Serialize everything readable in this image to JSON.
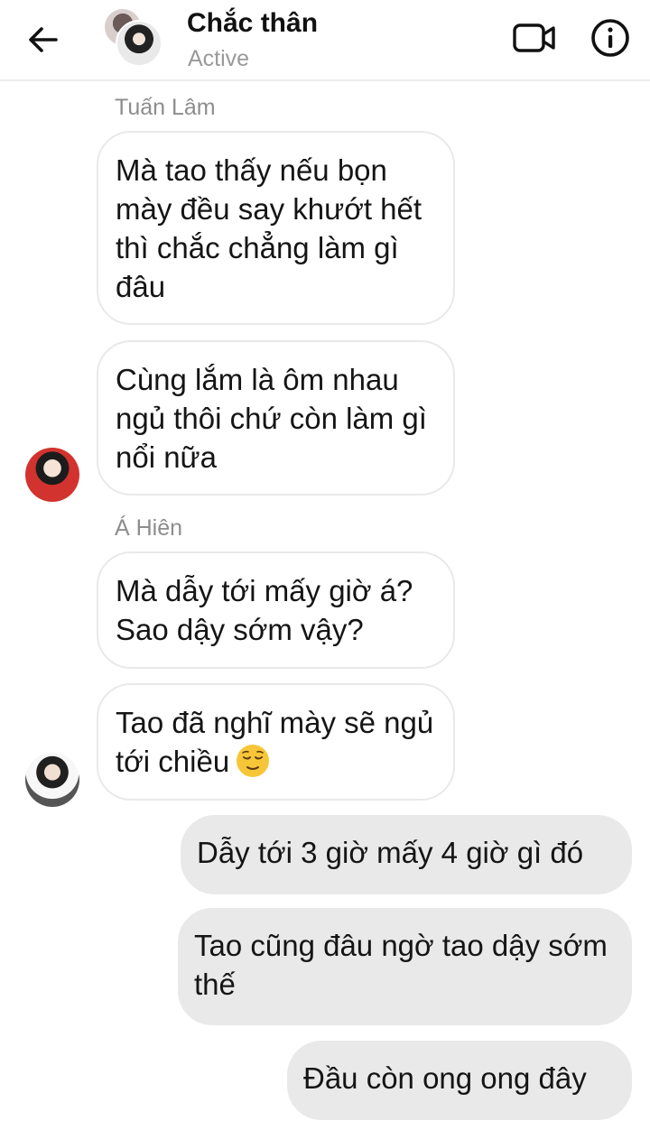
{
  "header": {
    "title": "Chắc thân",
    "status": "Active"
  },
  "messages": {
    "sender_tuan": "Tuấn Lâm",
    "tuan_1": "Mà tao thấy nếu bọn mày đều say khướt hết thì chắc chẳng làm gì đâu",
    "tuan_2": "Cùng lắm là ôm nhau ngủ thôi chứ còn làm gì nổi nữa",
    "sender_hien": "Á Hiên",
    "hien_1": "Mà dẫy tới mấy giờ á? Sao dậy sớm vậy?",
    "hien_2": "Tao đã nghĩ mày sẽ ngủ tới chiều",
    "me_1": "Dẫy tới 3 giờ mấy 4 giờ gì đó",
    "me_2": "Tao cũng đâu ngờ tao dậy sớm thế",
    "me_3": "Đầu còn ong ong đây"
  },
  "icons": {
    "back": "arrow-left-icon",
    "video": "video-camera-icon",
    "info": "info-icon",
    "emoji": "relieved-face-emoji"
  },
  "colors": {
    "incoming_bubble_border": "#e9e9e9",
    "outgoing_bubble_bg": "#e9e9e9",
    "muted_text": "#9a9a9a"
  }
}
